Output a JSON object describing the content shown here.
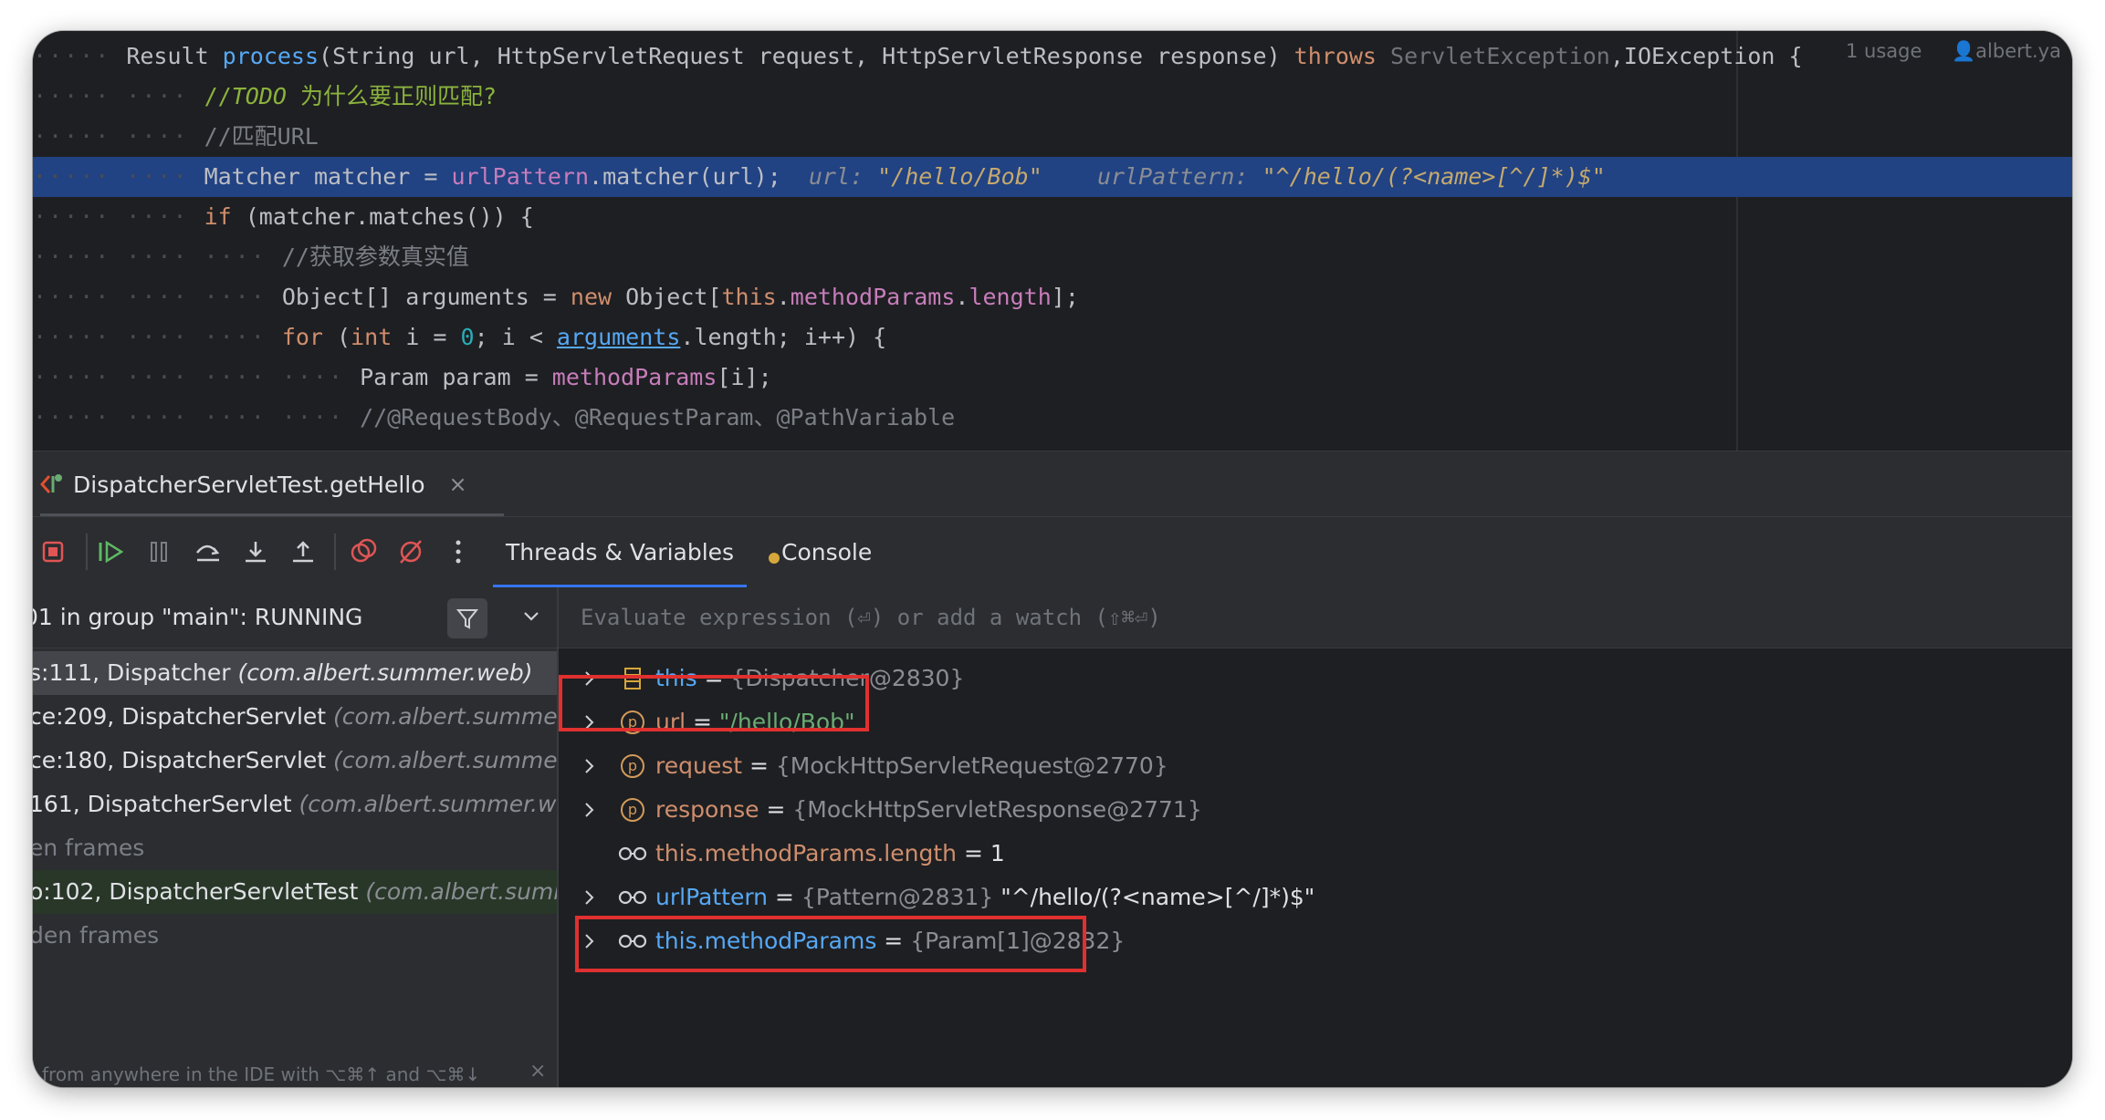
{
  "editor": {
    "lines": [
      {
        "parts": [
          {
            "t": "Result ",
            "c": ""
          },
          {
            "t": "process",
            "c": "c-fn"
          },
          {
            "t": "(String url, HttpServletRequest request, HttpServletResponse response) ",
            "c": ""
          },
          {
            "t": "throws ",
            "c": "c-kw"
          },
          {
            "t": "ServletException",
            "c": "c-dim"
          },
          {
            "t": ",IOException {",
            "c": ""
          }
        ],
        "indent": 0
      },
      {
        "parts": [
          {
            "t": "//",
            "c": "c-todo2"
          },
          {
            "t": "TODO",
            "c": "c-todo"
          },
          {
            "t": " 为什么要正则匹配?",
            "c": "c-todo2"
          }
        ],
        "indent": 1
      },
      {
        "parts": [
          {
            "t": "//匹配URL",
            "c": "c-cmt"
          }
        ],
        "indent": 1
      },
      {
        "parts": [
          {
            "t": "Matcher matcher = ",
            "c": ""
          },
          {
            "t": "urlPattern",
            "c": "c-field"
          },
          {
            "t": ".matcher(url);  ",
            "c": ""
          },
          {
            "t": "url: ",
            "c": "c-inlay"
          },
          {
            "t": "\"/hello/Bob\"    ",
            "c": "c-inlay-v"
          },
          {
            "t": "urlPattern: ",
            "c": "c-inlay"
          },
          {
            "t": "\"^/hello/(?<name>[^/]*)$\"",
            "c": "c-inlay-v"
          }
        ],
        "indent": 1,
        "highlight": true
      },
      {
        "parts": [
          {
            "t": "if ",
            "c": "c-kw"
          },
          {
            "t": "(matcher.matches()) {",
            "c": ""
          }
        ],
        "indent": 1
      },
      {
        "parts": [
          {
            "t": "//获取参数真实值",
            "c": "c-cmt"
          }
        ],
        "indent": 2
      },
      {
        "parts": [
          {
            "t": "Object[] arguments = ",
            "c": ""
          },
          {
            "t": "new ",
            "c": "c-kw"
          },
          {
            "t": "Object[",
            "c": ""
          },
          {
            "t": "this",
            "c": "c-kw"
          },
          {
            "t": ".",
            "c": ""
          },
          {
            "t": "methodParams",
            "c": "c-field"
          },
          {
            "t": ".",
            "c": ""
          },
          {
            "t": "length",
            "c": "c-field"
          },
          {
            "t": "];",
            "c": ""
          }
        ],
        "indent": 2
      },
      {
        "parts": [
          {
            "t": "for ",
            "c": "c-kw"
          },
          {
            "t": "(",
            "c": ""
          },
          {
            "t": "int ",
            "c": "c-kw"
          },
          {
            "t": "i = ",
            "c": ""
          },
          {
            "t": "0",
            "c": "c-num"
          },
          {
            "t": "; i < ",
            "c": ""
          },
          {
            "t": "arguments",
            "c": "c-link"
          },
          {
            "t": ".length; i++) {",
            "c": ""
          }
        ],
        "indent": 2
      },
      {
        "parts": [
          {
            "t": "Param param = ",
            "c": ""
          },
          {
            "t": "methodParams",
            "c": "c-field"
          },
          {
            "t": "[i];",
            "c": ""
          }
        ],
        "indent": 3
      },
      {
        "parts": [
          {
            "t": "//@RequestBody、@RequestParam、@PathVariable",
            "c": "c-cmt"
          }
        ],
        "indent": 3
      }
    ],
    "usage_hint": "1 usage",
    "author_hint": "albert.ya"
  },
  "run_tab": {
    "label": "DispatcherServletTest.getHello",
    "close": "×"
  },
  "debug_toolbar": {
    "icons": [
      "stop-icon",
      "resume-icon",
      "pause-icon",
      "step-over-icon",
      "step-into-icon",
      "step-out-icon",
      "view-breakpoints-icon",
      "mute-breakpoints-icon",
      "more-icon"
    ],
    "tabs": [
      "Threads & Variables",
      "Console"
    ]
  },
  "frames": {
    "thread_label": "01 in group \"main\": RUNNING",
    "rows": [
      {
        "method": "s:111, Dispatcher ",
        "cls": "(com.albert.summer.web)",
        "state": "selected"
      },
      {
        "method": "ce:209, DispatcherServlet ",
        "cls": "(com.albert.summer.web)",
        "state": ""
      },
      {
        "method": "ce:180, DispatcherServlet ",
        "cls": "(com.albert.summer.web)",
        "state": ""
      },
      {
        "method": "161, DispatcherServlet ",
        "cls": "(com.albert.summer.web)",
        "state": ""
      },
      {
        "method": "en frames",
        "cls": "",
        "state": "hidden"
      },
      {
        "method": "o:102, DispatcherServletTest ",
        "cls": "(com.albert.summer)",
        "state": "green"
      },
      {
        "method": "den frames",
        "cls": "",
        "state": "hidden"
      }
    ],
    "hint": "from anywhere in the IDE with ⌥⌘↑ and ⌥⌘↓",
    "hint_close": "×"
  },
  "variables": {
    "evaluate_placeholder": "Evaluate expression (⏎) or add a watch (⇧⌘⏎)",
    "rows": [
      {
        "expandable": true,
        "icon": "field-icon",
        "name": "this",
        "name_color": "blue",
        "eq": " = ",
        "value": "{Dispatcher@2830}",
        "value_kind": "ref",
        "extra": ""
      },
      {
        "expandable": true,
        "icon": "parameter-icon",
        "name": "url",
        "name_color": "orange",
        "eq": " = ",
        "value": "\"/hello/Bob\"",
        "value_kind": "str",
        "extra": ""
      },
      {
        "expandable": true,
        "icon": "parameter-icon",
        "name": "request",
        "name_color": "orange",
        "eq": " = ",
        "value": "{MockHttpServletRequest@2770}",
        "value_kind": "ref",
        "extra": ""
      },
      {
        "expandable": true,
        "icon": "parameter-icon",
        "name": "response",
        "name_color": "orange",
        "eq": " = ",
        "value": "{MockHttpServletResponse@2771}",
        "value_kind": "ref",
        "extra": ""
      },
      {
        "expandable": false,
        "icon": "watch-icon",
        "name": "this.methodParams.length",
        "name_color": "orange",
        "eq": " = ",
        "value": "1",
        "value_kind": "plain",
        "extra": ""
      },
      {
        "expandable": true,
        "icon": "watch-icon",
        "name": "urlPattern",
        "name_color": "blue",
        "eq": " = ",
        "value": "{Pattern@2831}",
        "value_kind": "ref",
        "extra": " \"^/hello/(?<name>[^/]*)$\""
      },
      {
        "expandable": true,
        "icon": "watch-icon",
        "name": "this.methodParams",
        "name_color": "blue",
        "eq": " = ",
        "value": "{Param[1]@2832}",
        "value_kind": "ref",
        "extra": ""
      }
    ]
  },
  "colors": {
    "editor_bg": "#1e1f22",
    "panel_bg": "#2b2d30",
    "highlight_line": "#214283",
    "annotation_red": "#e0302f",
    "accent_blue": "#3574f0"
  }
}
